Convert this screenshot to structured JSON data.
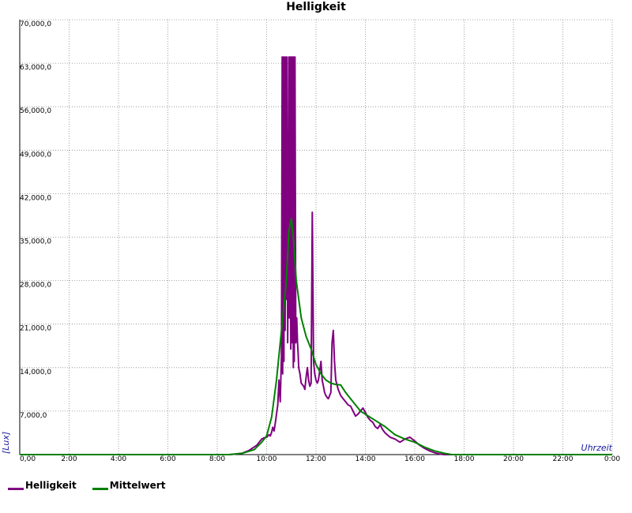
{
  "chart_data": {
    "type": "line",
    "title": "Helligkeit",
    "xlabel": "Uhrzeit",
    "ylabel": "[Lux]",
    "xlim": [
      0,
      24
    ],
    "ylim": [
      0,
      70000
    ],
    "grid": true,
    "legend_position": "bottom-left",
    "x_tick_labels": [
      "0,00",
      "2:00",
      "4:00",
      "6:00",
      "8:00",
      "10:00",
      "12:00",
      "14:00",
      "16:00",
      "18:00",
      "20:00",
      "22:00",
      "0:00"
    ],
    "y_tick_labels": [
      "7,000,0",
      "14,000,0",
      "21,000,0",
      "28,000,0",
      "35,000,0",
      "42,000,0",
      "49,000,0",
      "56,000,0",
      "63,000,0",
      "70,000,0"
    ],
    "series": [
      {
        "name": "Helligkeit",
        "color": "#800080",
        "x": [
          0,
          8.5,
          9.0,
          9.3,
          9.6,
          9.8,
          9.9,
          10.0,
          10.1,
          10.15,
          10.2,
          10.25,
          10.3,
          10.35,
          10.4,
          10.45,
          10.5,
          10.55,
          10.6,
          10.63,
          10.65,
          10.68,
          10.7,
          10.72,
          10.75,
          10.78,
          10.8,
          10.82,
          10.85,
          10.88,
          10.9,
          10.92,
          10.95,
          10.98,
          11.0,
          11.02,
          11.05,
          11.08,
          11.1,
          11.12,
          11.15,
          11.18,
          11.2,
          11.22,
          11.25,
          11.28,
          11.3,
          11.35,
          11.4,
          11.5,
          11.55,
          11.6,
          11.65,
          11.7,
          11.75,
          11.8,
          11.85,
          11.9,
          11.95,
          12.0,
          12.05,
          12.1,
          12.15,
          12.2,
          12.25,
          12.3,
          12.35,
          12.4,
          12.45,
          12.5,
          12.55,
          12.6,
          12.65,
          12.7,
          12.75,
          12.8,
          12.9,
          13.0,
          13.1,
          13.2,
          13.3,
          13.4,
          13.5,
          13.6,
          13.7,
          13.8,
          13.9,
          14.0,
          14.1,
          14.2,
          14.3,
          14.4,
          14.5,
          14.6,
          14.7,
          14.8,
          15.0,
          15.2,
          15.4,
          15.6,
          15.8,
          16.0,
          16.2,
          16.4,
          16.6,
          16.8,
          17.0,
          17.2,
          17.5,
          24
        ],
        "values": [
          0,
          0,
          200,
          700,
          1500,
          2500,
          2700,
          2800,
          3200,
          3000,
          3600,
          4400,
          3800,
          5000,
          6500,
          8000,
          12000,
          8500,
          16000,
          64000,
          13000,
          64000,
          15000,
          64000,
          20000,
          64000,
          25000,
          64000,
          18000,
          30000,
          64000,
          22000,
          64000,
          17000,
          64000,
          18000,
          64000,
          14000,
          64000,
          15000,
          64000,
          18000,
          20000,
          22000,
          18000,
          16000,
          14000,
          13000,
          11500,
          11000,
          10500,
          12500,
          14000,
          12000,
          11000,
          11500,
          39000,
          15000,
          13000,
          12000,
          11500,
          12000,
          13500,
          15000,
          12000,
          11000,
          10000,
          9500,
          9200,
          9000,
          9500,
          10000,
          18000,
          20000,
          15000,
          12000,
          10500,
          9500,
          9000,
          8500,
          8000,
          7800,
          7000,
          6200,
          6500,
          7000,
          7500,
          6800,
          6000,
          5500,
          5200,
          4500,
          4200,
          4800,
          4000,
          3500,
          2800,
          2500,
          2000,
          2500,
          2800,
          2200,
          1500,
          1000,
          600,
          300,
          100,
          0,
          0,
          0
        ]
      },
      {
        "name": "Mittelwert",
        "color": "#008000",
        "x": [
          0,
          8.5,
          9.0,
          9.5,
          9.8,
          10.0,
          10.2,
          10.4,
          10.6,
          10.8,
          10.9,
          11.0,
          11.1,
          11.2,
          11.4,
          11.6,
          11.8,
          12.0,
          12.2,
          12.4,
          12.6,
          12.8,
          13.0,
          13.2,
          13.4,
          13.6,
          13.8,
          14.0,
          14.4,
          14.8,
          15.2,
          15.6,
          16.0,
          16.4,
          16.8,
          17.2,
          17.5,
          24
        ],
        "values": [
          0,
          0,
          200,
          800,
          2000,
          3000,
          6000,
          12000,
          20000,
          28000,
          36000,
          38000,
          34000,
          28000,
          22000,
          19000,
          17000,
          14500,
          13000,
          12000,
          11500,
          11300,
          11200,
          10000,
          9000,
          8000,
          7000,
          6500,
          5500,
          4500,
          3200,
          2500,
          2000,
          1200,
          600,
          200,
          0,
          0
        ]
      }
    ]
  }
}
